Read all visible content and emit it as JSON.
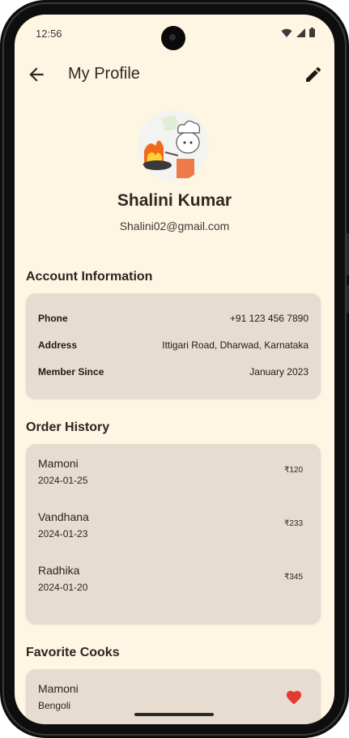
{
  "status_bar": {
    "time": "12:56",
    "icons": [
      "wifi-icon",
      "signal-icon",
      "battery-icon"
    ]
  },
  "app_bar": {
    "title": "My Profile",
    "back_icon": "arrow-left-icon",
    "edit_icon": "pencil-icon"
  },
  "profile": {
    "name": "Shalini Kumar",
    "email": "Shalini02@gmail.com",
    "avatar": "chef-cooking-illustration"
  },
  "account": {
    "title": "Account Information",
    "rows": [
      {
        "label": "Phone",
        "value": "+91 123 456 7890"
      },
      {
        "label": "Address",
        "value": "Ittigari Road, Dharwad, Karnataka"
      },
      {
        "label": "Member Since",
        "value": "January 2023"
      }
    ]
  },
  "orders": {
    "title": "Order History",
    "items": [
      {
        "name": "Mamoni",
        "date": "2024-01-25",
        "price": "₹120"
      },
      {
        "name": "Vandhana",
        "date": "2024-01-23",
        "price": "₹233"
      },
      {
        "name": "Radhika",
        "date": "2024-01-20",
        "price": "₹345"
      }
    ]
  },
  "favorites": {
    "title": "Favorite Cooks",
    "items": [
      {
        "name": "Mamoni",
        "cuisine": "Bengoli",
        "icon": "heart-icon"
      }
    ]
  },
  "colors": {
    "background": "#fff5e3",
    "card": "#e6ddd0",
    "heart": "#e53935",
    "text": "#2a2620"
  }
}
